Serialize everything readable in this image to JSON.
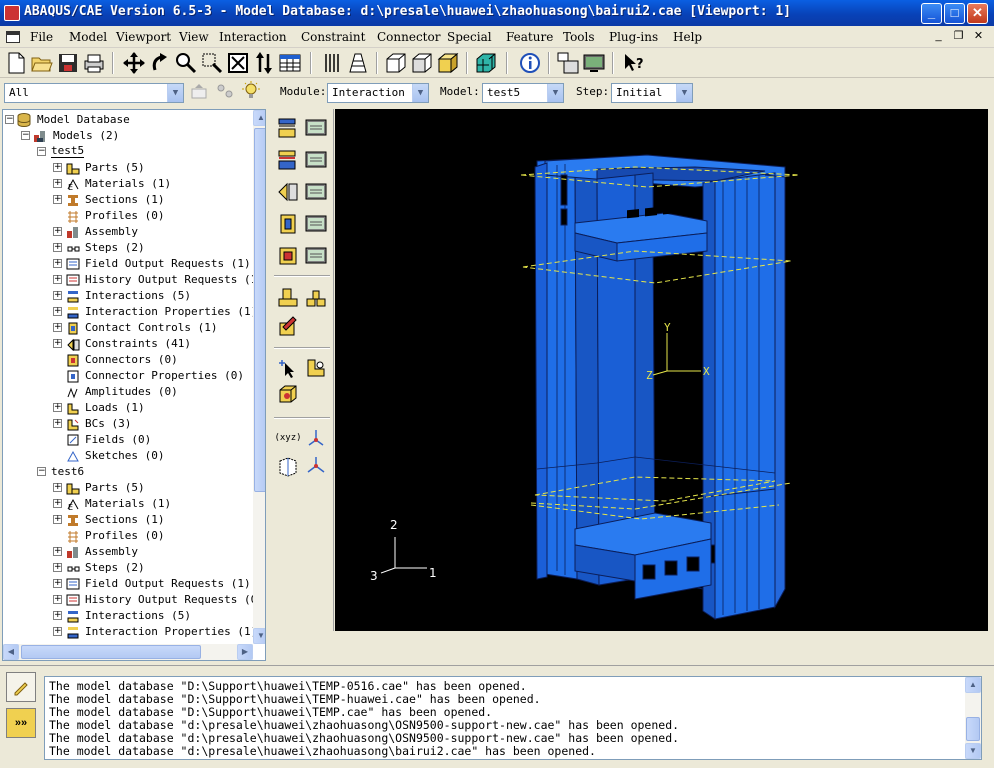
{
  "window": {
    "title": "ABAQUS/CAE Version 6.5-3 - Model Database: d:\\presale\\huawei\\zhaohuasong\\bairui2.cae [Viewport: 1]",
    "controls": {
      "minimize": "_",
      "maximize": "□",
      "close": "✕"
    }
  },
  "menu": {
    "items": [
      {
        "label": "File"
      },
      {
        "label": "Model"
      },
      {
        "label": "Viewport"
      },
      {
        "label": "View"
      },
      {
        "label": "Interaction"
      },
      {
        "label": "Constraint"
      },
      {
        "label": "Connector"
      },
      {
        "label": "Special"
      },
      {
        "label": "Feature"
      },
      {
        "label": "Tools"
      },
      {
        "label": "Plug-ins"
      },
      {
        "label": "Help"
      }
    ]
  },
  "toolbar": {
    "icons": [
      "new-file",
      "open-file",
      "save-file",
      "print",
      "pan",
      "rotate",
      "zoom",
      "box-zoom",
      "auto-fit",
      "cycle-views",
      "query",
      "render-wireframe",
      "render-hidden",
      "render-shaded",
      "iso-view",
      "front-view",
      "side-view",
      "mesh-render",
      "info",
      "viewport-a",
      "viewport-b",
      "help-pointer"
    ]
  },
  "context": {
    "filter_value": "All",
    "module_label": "Module:",
    "module_value": "Interaction",
    "model_label": "Model:",
    "model_value": "test5",
    "step_label": "Step:",
    "step_value": "Initial"
  },
  "tree": {
    "root": "Model Database",
    "models": "Models (2)",
    "test5": {
      "name": "test5",
      "items": [
        "Parts (5)",
        "Materials (1)",
        "Sections (1)",
        "Profiles (0)",
        "Assembly",
        "Steps (2)",
        "Field Output Requests (1)",
        "History Output Requests (1)",
        "Interactions (5)",
        "Interaction Properties (1)",
        "Contact Controls (1)",
        "Constraints (41)",
        "Connectors (0)",
        "Connector Properties (0)",
        "Amplitudes (0)",
        "Loads (1)",
        "BCs (3)",
        "Fields (0)",
        "Sketches (0)"
      ]
    },
    "test6": {
      "name": "test6",
      "items": [
        "Parts (5)",
        "Materials (1)",
        "Sections (1)",
        "Profiles (0)",
        "Assembly",
        "Steps (2)",
        "Field Output Requests (1)",
        "History Output Requests (0)",
        "Interactions (5)",
        "Interaction Properties (1)"
      ]
    }
  },
  "viewport": {
    "triad_local": {
      "x": "X",
      "y": "Y",
      "z": "Z"
    },
    "triad_global": {
      "one": "1",
      "two": "2",
      "three": "3"
    },
    "model_color": "#1f6ee8",
    "edge_color": "#0b1e5a",
    "datum_color": "#e6e64a"
  },
  "messages": [
    "The model database \"D:\\Support\\huawei\\TEMP-0516.cae\" has been opened.",
    "The model database \"D:\\Support\\huawei\\TEMP-huawei.cae\" has been opened.",
    "The model database \"D:\\Support\\huawei\\TEMP.cae\" has been opened.",
    "The model database \"d:\\presale\\huawei\\zhaohuasong\\OSN9500-support-new.cae\" has been opened.",
    "The model database \"d:\\presale\\huawei\\zhaohuasong\\OSN9500-support-new.cae\" has been opened.",
    "The model database \"d:\\presale\\huawei\\zhaohuasong\\bairui2.cae\" has been opened."
  ],
  "message_buttons": {
    "kernel": "»»"
  }
}
